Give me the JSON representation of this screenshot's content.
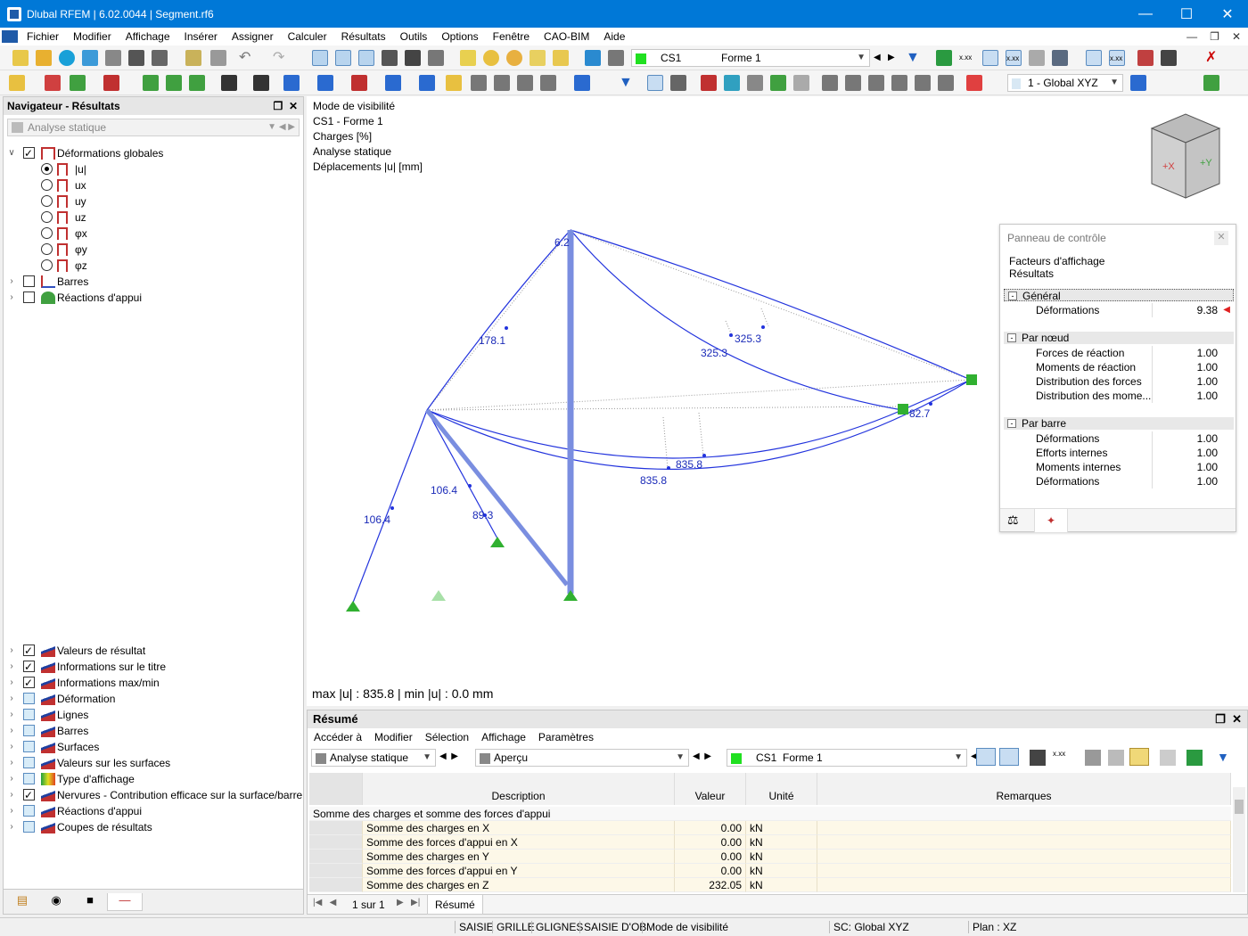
{
  "window": {
    "title": "Dlubal RFEM | 6.02.0044 | Segment.rf6"
  },
  "menu": [
    "Fichier",
    "Modifier",
    "Affichage",
    "Insérer",
    "Assigner",
    "Calculer",
    "Résultats",
    "Outils",
    "Options",
    "Fenêtre",
    "CAO-BIM",
    "Aide"
  ],
  "toolbar": {
    "load_case": "CS1",
    "load_case_name": "Forme 1",
    "coord_system": "1 - Global XYZ"
  },
  "navigator": {
    "title": "Navigateur - Résultats",
    "combo": "Analyse statique",
    "deformations": "Déformations globales",
    "components": [
      "|u|",
      "ux",
      "uy",
      "uz",
      "φx",
      "φy",
      "φz"
    ],
    "barres": "Barres",
    "reactions": "Réactions d'appui",
    "bottom_items": [
      {
        "label": "Valeurs de résultat",
        "checked": true
      },
      {
        "label": "Informations sur le titre",
        "checked": true
      },
      {
        "label": "Informations max/min",
        "checked": true
      },
      {
        "label": "Déformation",
        "checked": false
      },
      {
        "label": "Lignes",
        "checked": false
      },
      {
        "label": "Barres",
        "checked": false
      },
      {
        "label": "Surfaces",
        "checked": false
      },
      {
        "label": "Valeurs sur les surfaces",
        "checked": false
      },
      {
        "label": "Type d'affichage",
        "checked": false
      },
      {
        "label": "Nervures - Contribution efficace sur la surface/barre",
        "checked": true
      },
      {
        "label": "Réactions d'appui",
        "checked": false
      },
      {
        "label": "Coupes de résultats",
        "checked": false
      }
    ]
  },
  "view": {
    "info": [
      "Mode de visibilité",
      "CS1 - Forme 1",
      "Charges [%]",
      "Analyse statique",
      "Déplacements |u| [mm]"
    ],
    "maxmin": "max |u| : 835.8 | min |u| : 0.0 mm",
    "labels": {
      "l1": "6.2",
      "l2": "178.1",
      "l3": "325.3",
      "l4": "325.3",
      "l5": "82.7",
      "l6": "835.8",
      "l7": "835.8",
      "l8": "106.4",
      "l9": "106.4",
      "l10": "89.3"
    },
    "cube": {
      "x": "+X",
      "y": "+Y"
    }
  },
  "control_panel": {
    "title": "Panneau de contrôle",
    "subtitle1": "Facteurs d'affichage",
    "subtitle2": "Résultats",
    "general": "Général",
    "general_rows": [
      {
        "label": "Déformations",
        "value": "9.38"
      }
    ],
    "node": "Par nœud",
    "node_rows": [
      {
        "label": "Forces de réaction",
        "value": "1.00"
      },
      {
        "label": "Moments de réaction",
        "value": "1.00"
      },
      {
        "label": "Distribution des forces",
        "value": "1.00"
      },
      {
        "label": "Distribution des mome...",
        "value": "1.00"
      }
    ],
    "member": "Par barre",
    "member_rows": [
      {
        "label": "Déformations",
        "value": "1.00"
      },
      {
        "label": "Efforts internes",
        "value": "1.00"
      },
      {
        "label": "Moments internes",
        "value": "1.00"
      },
      {
        "label": "Déformations",
        "value": "1.00"
      }
    ]
  },
  "summary": {
    "title": "Résumé",
    "menu": [
      "Accéder à",
      "Modifier",
      "Sélection",
      "Affichage",
      "Paramètres"
    ],
    "combo1": "Analyse statique",
    "combo2": "Aperçu",
    "lc": "CS1",
    "lc_name": "Forme 1",
    "columns": {
      "desc": "Description",
      "value": "Valeur",
      "unit": "Unité",
      "remarks": "Remarques"
    },
    "group": "Somme des charges et somme des forces d'appui",
    "rows": [
      {
        "desc": "Somme des charges en X",
        "value": "0.00",
        "unit": "kN"
      },
      {
        "desc": "Somme des forces d'appui en X",
        "value": "0.00",
        "unit": "kN"
      },
      {
        "desc": "Somme des charges en Y",
        "value": "0.00",
        "unit": "kN"
      },
      {
        "desc": "Somme des forces d'appui en Y",
        "value": "0.00",
        "unit": "kN"
      },
      {
        "desc": "Somme des charges en Z",
        "value": "232.05",
        "unit": "kN"
      }
    ],
    "pager": "1 sur 1",
    "tab": "Résumé"
  },
  "status": {
    "s1": "SAISIE",
    "s2": "GRILLE",
    "s3": "GLIGNES",
    "s4": "SAISIE D'OB",
    "s5": "Mode de visibilité",
    "s6": "SC: Global XYZ",
    "s7": "Plan : XZ"
  }
}
